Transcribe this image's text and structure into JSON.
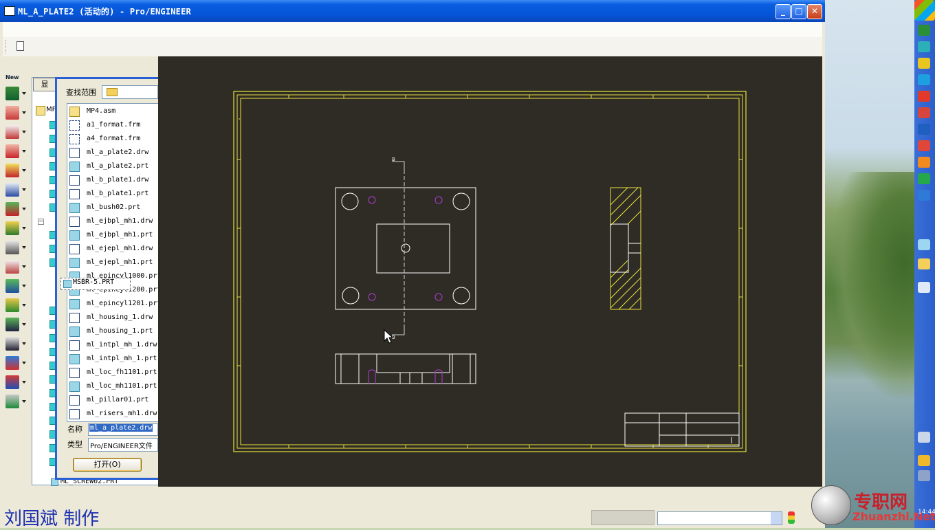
{
  "window": {
    "title": "ML_A_PLATE2 (活动的) - Pro/ENGINEER",
    "minimize_label": "_",
    "maximize_label": "□",
    "close_label": "✕"
  },
  "tree": {
    "show_button": "显",
    "root_label": "MF",
    "bottom_item": "ML_SCREW02.PRT"
  },
  "left_toolbar": {
    "top_label": "New"
  },
  "dialog": {
    "lookin_label": "查找范围",
    "files": [
      {
        "name": "MP4.asm",
        "kind": "asm"
      },
      {
        "name": "a1_format.frm",
        "kind": "frm"
      },
      {
        "name": "a4_format.frm",
        "kind": "frm"
      },
      {
        "name": "ml_a_plate2.drw",
        "kind": "drw"
      },
      {
        "name": "ml_a_plate2.prt",
        "kind": "prt"
      },
      {
        "name": "ml_b_plate1.drw",
        "kind": "drw"
      },
      {
        "name": "ml_b_plate1.prt",
        "kind": "drw"
      },
      {
        "name": "ml_bush02.prt",
        "kind": "prt"
      },
      {
        "name": "ml_ejbpl_mh1.drw",
        "kind": "drw"
      },
      {
        "name": "ml_ejbpl_mh1.prt",
        "kind": "prt"
      },
      {
        "name": "ml_ejepl_mh1.drw",
        "kind": "drw"
      },
      {
        "name": "ml_ejepl_mh1.prt",
        "kind": "prt"
      },
      {
        "name": "ml_epincyl1000.prt",
        "kind": "prt"
      },
      {
        "name": "ml_epincyl1200.prt",
        "kind": "prt"
      },
      {
        "name": "ml_epincyl1201.prt",
        "kind": "prt"
      },
      {
        "name": "ml_housing_1.drw",
        "kind": "drw"
      },
      {
        "name": "ml_housing_1.prt",
        "kind": "prt"
      },
      {
        "name": "ml_intpl_mh_1.drw",
        "kind": "drw"
      },
      {
        "name": "ml_intpl_mh_1.prt",
        "kind": "prt"
      },
      {
        "name": "ml_loc_fh1101.prt",
        "kind": "drw"
      },
      {
        "name": "ml_loc_mh1101.prt",
        "kind": "prt"
      },
      {
        "name": "ml_pillar01.prt",
        "kind": "drw"
      },
      {
        "name": "ml_risers_mh1.drw",
        "kind": "drw"
      }
    ],
    "drag_item": "MSBR-5.PRT",
    "name_label": "名称",
    "name_value": "ml_a_plate2.drw",
    "type_label": "类型",
    "type_value": "Pro/ENGINEER文件",
    "open_button": "打开(O)"
  },
  "drawing": {
    "section_label_top": "B",
    "section_label_bottom": "B"
  },
  "status": {
    "credit": "刘国斌 制作"
  },
  "watermark": {
    "text": "专职网",
    "url": "Zhuanzhi.Net"
  },
  "taskbar": {
    "clock": "14:44"
  }
}
